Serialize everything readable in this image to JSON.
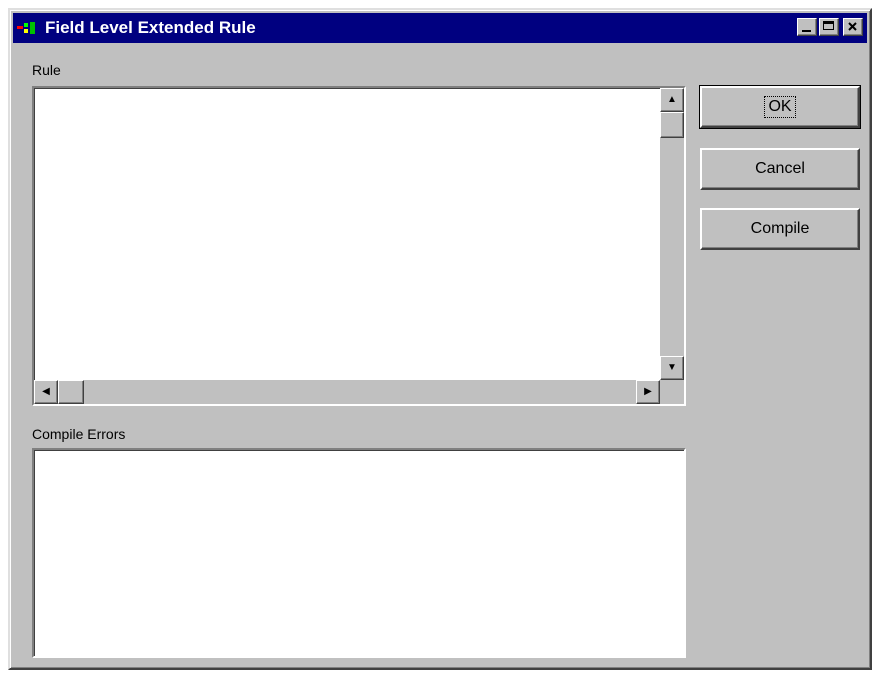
{
  "window": {
    "title": "Field Level Extended Rule",
    "titlebar_color": "#000080",
    "face_color": "#c0c0c0"
  },
  "title_buttons": [
    {
      "name": "minimize-button",
      "icon": "minimize-icon"
    },
    {
      "name": "maximize-button",
      "icon": "maximize-icon"
    },
    {
      "name": "close-button",
      "icon": "close-icon"
    }
  ],
  "rule": {
    "label": "Rule",
    "value": ""
  },
  "compile_errors": {
    "label": "Compile Errors",
    "value": ""
  },
  "buttons": {
    "ok": "OK",
    "cancel": "Cancel",
    "compile": "Compile"
  },
  "icons": {
    "scroll_up": "▲",
    "scroll_down": "▼",
    "scroll_left": "◀",
    "scroll_right": "▶"
  }
}
